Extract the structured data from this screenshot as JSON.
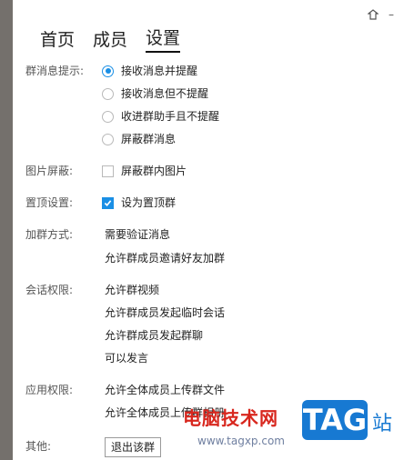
{
  "tabs": [
    {
      "label": "首页",
      "active": false
    },
    {
      "label": "成员",
      "active": false
    },
    {
      "label": "设置",
      "active": true
    }
  ],
  "titlebar": {
    "icons": [
      "skin-icon",
      "minimize-icon"
    ],
    "minimize_glyph": "–"
  },
  "settings": {
    "notify": {
      "label": "群消息提示:",
      "options": [
        {
          "label": "接收消息并提醒",
          "selected": true
        },
        {
          "label": "接收消息但不提醒",
          "selected": false
        },
        {
          "label": "收进群助手且不提醒",
          "selected": false
        },
        {
          "label": "屏蔽群消息",
          "selected": false
        }
      ]
    },
    "image_block": {
      "label": "图片屏蔽:",
      "option": "屏蔽群内图片",
      "checked": false
    },
    "pin": {
      "label": "置顶设置:",
      "option": "设为置顶群",
      "checked": true
    },
    "join": {
      "label": "加群方式:",
      "items": [
        "需要验证消息",
        "允许群成员邀请好友加群"
      ]
    },
    "session": {
      "label": "会话权限:",
      "items": [
        "允许群视频",
        "允许群成员发起临时会话",
        "允许群成员发起群聊",
        "可以发言"
      ]
    },
    "app": {
      "label": "应用权限:",
      "items": [
        "允许全体成员上传群文件",
        "允许全体成员上传群相册"
      ]
    },
    "other": {
      "label": "其他:",
      "button": "退出该群"
    }
  },
  "watermark": {
    "title": "电脑技术网",
    "url": "www.tagxp.com",
    "tag": "TAG",
    "suffix": "站"
  },
  "colors": {
    "accent": "#1a8fe5",
    "side_strip": "#74706c"
  }
}
